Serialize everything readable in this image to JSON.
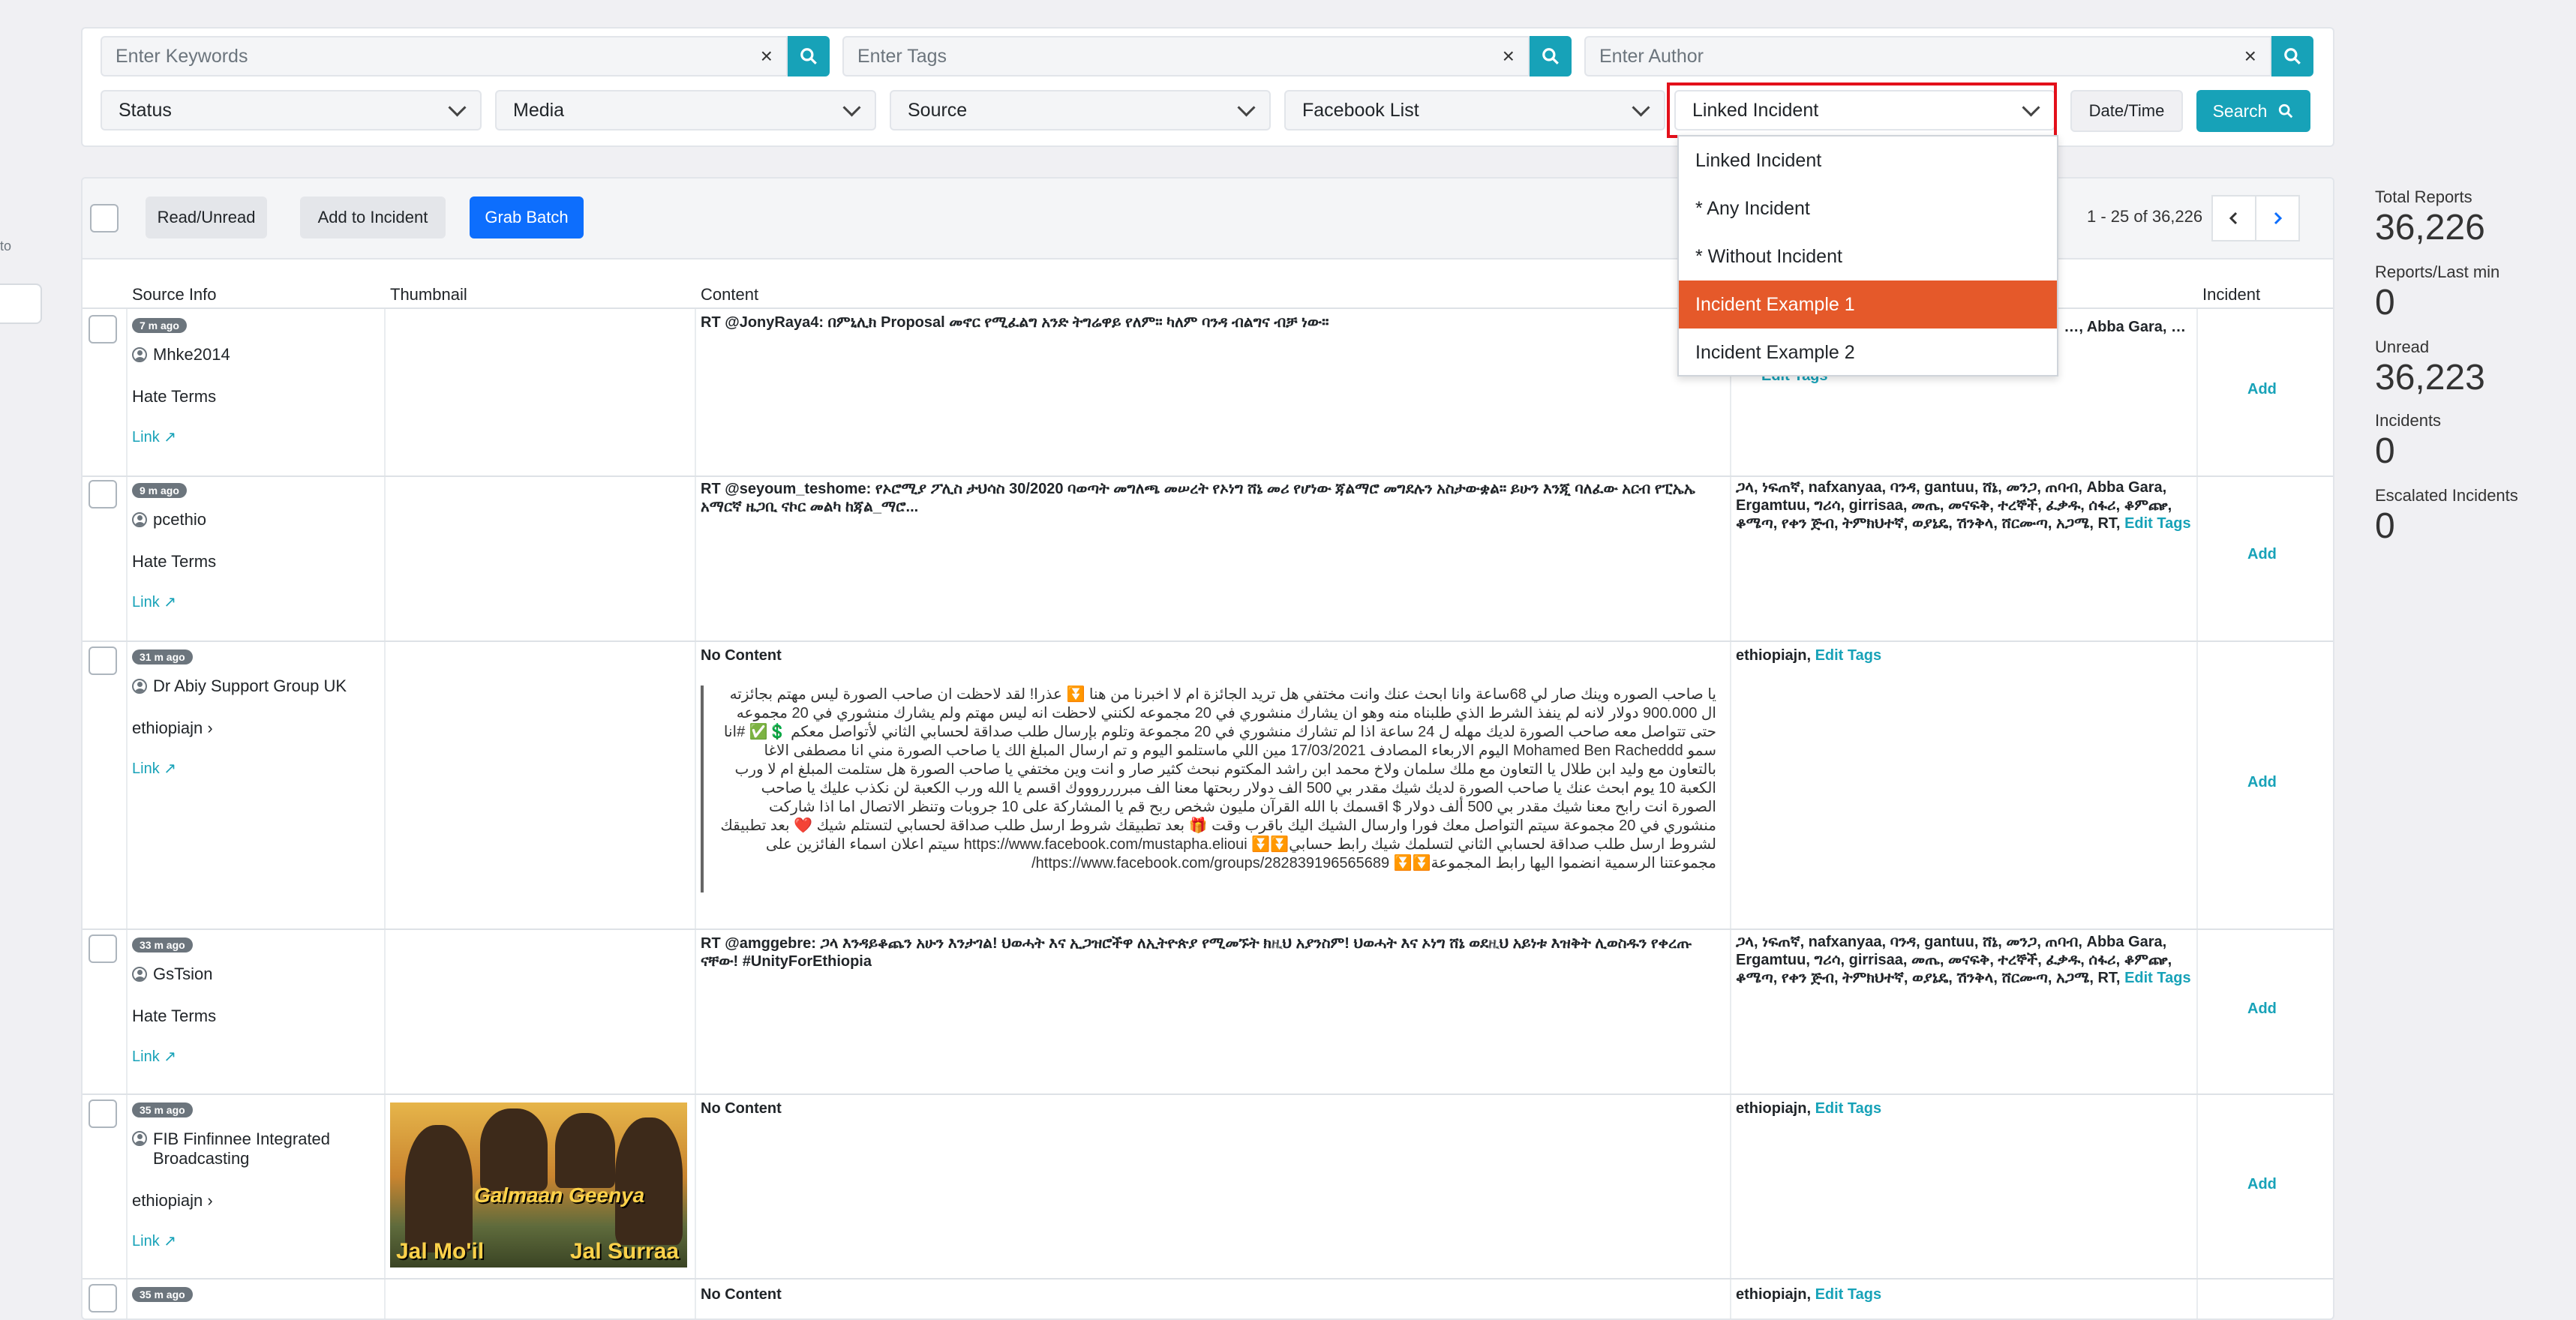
{
  "left_stub": {
    "text": "to"
  },
  "filters": {
    "keywords_placeholder": "Enter Keywords",
    "tags_placeholder": "Enter Tags",
    "author_placeholder": "Enter Author",
    "clear_glyph": "×",
    "status_label": "Status",
    "media_label": "Media",
    "source_label": "Source",
    "facebook_list_label": "Facebook List",
    "linked_incident_label": "Linked Incident",
    "datetime_label": "Date/Time",
    "search_label": "Search"
  },
  "dropdown": {
    "options": [
      "Linked Incident",
      "* Any Incident",
      "* Without Incident",
      "Incident Example 1",
      "Incident Example 2"
    ],
    "highlighted": "Incident Example 1"
  },
  "toolbar": {
    "read_unread_label": "Read/Unread",
    "add_to_incident_label": "Add to Incident",
    "grab_batch_label": "Grab Batch",
    "pagination_text": "1 - 25 of 36,226"
  },
  "table": {
    "headers": {
      "source": "Source Info",
      "thumbnail": "Thumbnail",
      "content": "Content",
      "incident": "Incident"
    },
    "rows": [
      {
        "time": "7 m ago",
        "user": "Mhke2014",
        "source_label": "Hate Terms",
        "link": "Link",
        "content": "RT @JonyRaya4: በምኒሊክ Proposal መኖር የሚፈልግ አንድ ትግሬዋይ የለም። ካለም ባንዳ ብልግና ብቻ ነው።",
        "tags_partial": "…, Abba Gara, …",
        "edit_tags": "Edit Tags",
        "add": "Add"
      },
      {
        "time": "9 m ago",
        "user": "pcethio",
        "source_label": "Hate Terms",
        "link": "Link",
        "content": "RT @seyoum_teshome: የኦሮሚያ ፖሊስ ታህሳስ 30/2020 ባወጣት መግለጫ መሠረት የኦነግ ሸኔ መሪ የሆነው ጃልማሮ መግደሉን አስታውቋል። ይሁን እንጂ ባለፈው አርብ የፒኤኤ አማርኛ ዜጋቢ ናኮር መልካ ከጃል_ማሮ...",
        "tags": "ጋላ, ነፍጠኛ, nafxanyaa, ባንዳ, gantuu, ሸኔ, መንጋ, ጠባብ, Abba Gara, Ergamtuu, ግሪሳ, girrisaa, መጤ, መናፍቅ, ተረኞች, ፈቃዱ, ሰፋሪ, ቆምጬ, ቆሜጣ, የቀን ጅብ, ትምክህተኛ, ወያኔዴ, ሽንቅላ, ሸርሙጣ, አጋሜ, RT,",
        "edit_tags": "Edit Tags",
        "add": "Add"
      },
      {
        "time": "31 m ago",
        "user": "Dr Abiy Support Group UK",
        "source_label": "ethiopiajn",
        "link": "Link",
        "content": "No Content",
        "quote": "يا صاحب الصوره وينك صار لي 68ساعة وانا ابحث عنك وانت مختفي هل تريد الجائزة ام لا اخبرنا من هنا ⏬ عذرا! لقد لاحظت ان صاحب الصورة ليس مهتم بجائزته ال 900.000 دولار لانه لم ينفذ الشرط الذي طلبناه منه وهو ان يشارك منشوري في 20 مجموعه لكنني لاحظت انه ليس مهتم ولم يشارك منشوري في 20 مجموعه حتى تتواصل معه صاحب الصورة لديك مهله ل 24 ساعة اذا لم تشارك منشوري في 20 مجموعة وتلوم بإرسال طلب صداقة لحسابي الثاني لأتواصل معكم 💲✅ #انا سمو Mohamed Ben Racheddd اليوم الاربعاء المصادف 17/03/2021 مين اللي ماستلمو اليوم و تم ارسال المبلغ الك يا صاحب الصورة مني انا مصطفى الاغا بالتعاون مع وليد ابن طلال يا التعاون مع ملك سلمان ولاخ محمد ابن راشد المكتوم نبحث كثير صار و انت وين مختفي يا صاحب الصورة هل ستلمت المبلغ ام لا ورب الكعبة 10 يوم ابحث عنك يا صاحب الصورة لديك شيك مقدر بي 500 الف دولار ربحتها معنا الف مبرررروووك اقسم يا الله ورب الكعبة لن نكذب عليك يا صاحب الصورة انت رابح معنا شيك مقدر بي 500 ألف دولار $ اقسمك با الله القرآن مليون شخص ربح قم يا المشاركة على 10 جروبات وتنظر الاتصال اما اذا شاركت منشوري في 20 مجموعة سيتم التواصل معك فورا وارسال الشيك اليك باقرب وقت 🎁 بعد تطبيقك شروط ارسل طلب صداقة لحسابي لتستلم شيك ❤️ بعد تطبيقك لشروط ارسل طلب صداقة لحسابي الثاني لتسلمك شيك رابط حسابي⏬⏬ https://www.facebook.com/mustapha.elioui سيتم اعلان اسماء الفائزين على مجموعتنا الرسمية انضموا اليها رابط المجموعة⏬⏬ https://www.facebook.com/groups/282839196565689/",
        "tags": "ethiopiajn,",
        "edit_tags": "Edit Tags",
        "add": "Add"
      },
      {
        "time": "33 m ago",
        "user": "GsTsion",
        "source_label": "Hate Terms",
        "link": "Link",
        "content": "RT @amggebre: ጋላ እንዳይቆጨን አሁን እንታገል! ህወሓት እና ኢጋዝሮችዋ ለኢትዮጵያ የሚመኙት ክዚህ አያንስም! ህወሓት እና ኦነግ ሸኔ ወደዚህ አይነቱ እዝቅት ሊወስዱን የቀረጡ ናቸው! #UnityForEthiopia",
        "tags": "ጋላ, ነፍጠኛ, nafxanyaa, ባንዳ, gantuu, ሸኔ, መንጋ, ጠባብ, Abba Gara, Ergamtuu, ግሪሳ, girrisaa, መጤ, መናፍቅ, ተረኞች, ፈቃዱ, ሰፋሪ, ቆምጬ, ቆሜጣ, የቀን ጅብ, ትምክህተኛ, ወያኔዴ, ሽንቅላ, ሸርሙጣ, አጋሜ, RT,",
        "edit_tags": "Edit Tags",
        "add": "Add"
      },
      {
        "time": "35 m ago",
        "user": "FIB Finfinnee Integrated Broadcasting",
        "source_label": "ethiopiajn",
        "link": "Link",
        "content": "No Content",
        "thumb_title": "Galmaan Geenya",
        "thumb_left": "Jal Mo'il",
        "thumb_right": "Jal Surraa",
        "tags": "ethiopiajn,",
        "edit_tags": "Edit Tags",
        "add": "Add"
      },
      {
        "time": "35 m ago",
        "content": "No Content",
        "tags": "ethiopiajn,",
        "edit_tags": "Edit Tags"
      }
    ]
  },
  "stats": {
    "total_reports_label": "Total Reports",
    "total_reports": "36,226",
    "reports_per_min_label": "Reports/Last min",
    "reports_per_min": "0",
    "unread_label": "Unread",
    "unread": "36,223",
    "incidents_label": "Incidents",
    "incidents": "0",
    "escalated_label": "Escalated Incidents",
    "escalated": "0"
  },
  "colors": {
    "accent": "#17a2b8",
    "primary_button": "#0d6efd",
    "dropdown_highlight": "#e5592a",
    "highlight_outline": "#e3101a"
  }
}
